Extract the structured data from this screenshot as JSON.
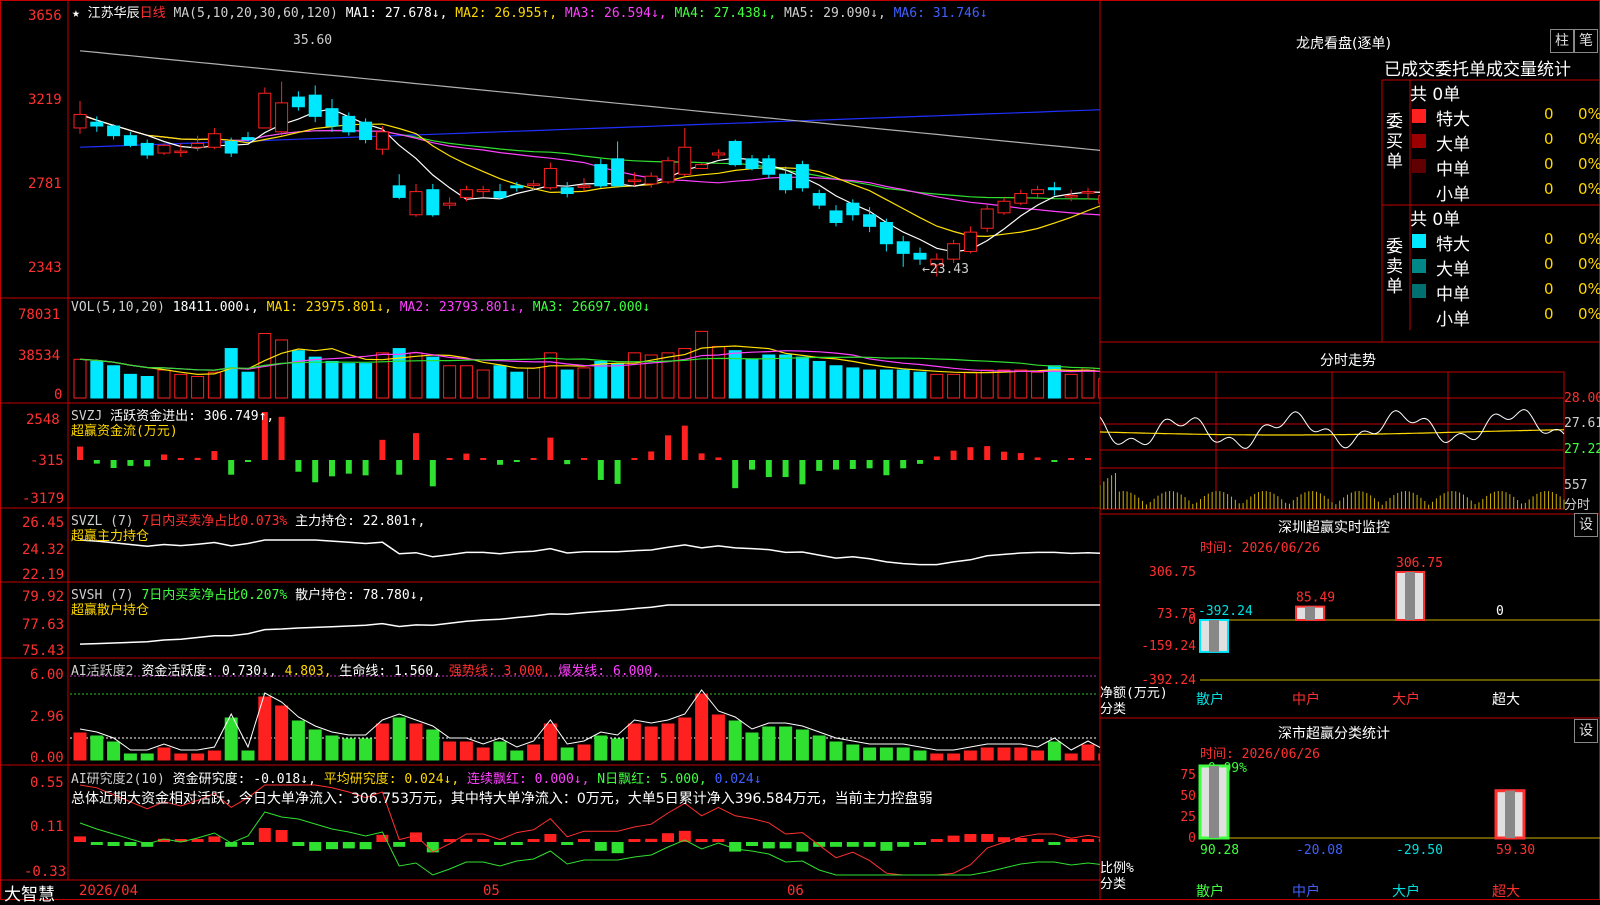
{
  "colors": {
    "up": "#ff2020",
    "down": "#00e8ff",
    "grid": "#c00000",
    "bg": "#000000",
    "ma1": "#ffffff",
    "ma2": "#ffe000",
    "ma3": "#ff40ff",
    "ma4": "#30e030",
    "ma5": "#b0b0b0",
    "ma6": "#2030ff"
  },
  "brand": "大智慧",
  "main": {
    "star": "★",
    "stock": "江苏华辰",
    "period": "日线",
    "ma_label": "MA(5,10,20,30,60,120)",
    "ma1": "MA1: 27.678↓,",
    "ma2": "MA2: 26.955↑,",
    "ma3": "MA3: 26.594↓,",
    "ma4": "MA4: 27.438↓,",
    "ma5": "MA5: 29.090↓,",
    "ma6": "MA6: 31.746↓",
    "y_ticks": [
      "3656",
      "3219",
      "2781",
      "2343"
    ],
    "high_note": "35.60",
    "low_note": "←23.43"
  },
  "vol": {
    "label": "VOL(5,10,20)",
    "v": "18411.000↓,",
    "ma1": "MA1: 23975.801↓,",
    "ma2": "MA2: 23793.801↓,",
    "ma3": "MA3: 26697.000↓",
    "y_ticks": [
      "78031",
      "38534",
      "0"
    ]
  },
  "svzj": {
    "label": "SVZJ",
    "t1": "活跃资金进出: 306.749↑,",
    "t2": "超赢资金流(万元)",
    "y_ticks": [
      "2548",
      "-315",
      "-3179"
    ]
  },
  "svzl": {
    "label": "SVZL (7)",
    "t1": "7日内买卖净占比0.073%",
    "t2": "主力持仓: 22.801↑,",
    "t3": "超赢主力持仓",
    "y_ticks": [
      "26.45",
      "24.32",
      "22.19"
    ]
  },
  "svsh": {
    "label": "SVSH (7)",
    "t1": "7日内买卖净占比0.207%",
    "t2": "散户持仓: 78.780↓,",
    "t3": "超赢散户持仓",
    "y_ticks": [
      "79.92",
      "77.63",
      "75.43"
    ]
  },
  "ai1": {
    "label": "AI活跃度2",
    "t1": "资金活跃度: 0.730↓,",
    "t2": "4.803,",
    "t3": "生命线: 1.560,",
    "t4": "强势线: 3.000,",
    "t5": "爆发线: 6.000,",
    "y_ticks": [
      "6.00",
      "2.96",
      "0.00"
    ]
  },
  "ai2": {
    "label": "AI研究度2(10)",
    "t1": "资金研究度: -0.018↓,",
    "t2": "平均研究度: 0.024↓,",
    "t3": "连续飘红: 0.000↓,",
    "t4": "N日飘红: 5.000,",
    "t5": "0.024↓",
    "summary": "总体近期大资金相对活跃，今日大单净流入：306.753万元，其中特大单净流入：0万元，大单5日累计净入396.584万元，当前主力控盘弱",
    "y_ticks": [
      "0.55",
      "0.11",
      "-0.33"
    ]
  },
  "date_axis": {
    "d1": "2026/04",
    "d2": "05",
    "d3": "06"
  },
  "right": {
    "title": "龙虎看盘(逐单)",
    "btn1": "柱",
    "btn2": "笔",
    "subtitle": "已成交委托单成交量统计",
    "buy": {
      "side": "委买单",
      "total": "共 0单",
      "rows": [
        {
          "name": "特大",
          "vol": "0",
          "pct": "0%",
          "color": "#ff2020"
        },
        {
          "name": "大单",
          "vol": "0",
          "pct": "0%",
          "color": "#9a0000"
        },
        {
          "name": "中单",
          "vol": "0",
          "pct": "0%",
          "color": "#600000"
        },
        {
          "name": "小单",
          "vol": "0",
          "pct": "0%",
          "color": ""
        }
      ]
    },
    "sell": {
      "side": "委卖单",
      "total": "共 0单",
      "rows": [
        {
          "name": "特大",
          "vol": "0",
          "pct": "0%",
          "color": "#00e8ff"
        },
        {
          "name": "大单",
          "vol": "0",
          "pct": "0%",
          "color": "#008888"
        },
        {
          "name": "中单",
          "vol": "0",
          "pct": "0%",
          "color": "#007070"
        },
        {
          "name": "小单",
          "vol": "0",
          "pct": "0%",
          "color": ""
        }
      ]
    },
    "intraday": {
      "title": "分时走势",
      "p1": "28.00",
      "p2": "27.61",
      "p3": "27.22",
      "vol": "557",
      "unit": "分时"
    },
    "monitor": {
      "title": "深圳超赢实时监控",
      "btn": "设",
      "time": "时间: 2026/06/26",
      "y_ticks": [
        "306.75",
        "73.75",
        "0",
        "-159.24",
        "-392.24"
      ],
      "ylabel1": "净额(万元)",
      "ylabel2": "分类",
      "cats": [
        "散户",
        "中户",
        "大户",
        "超大"
      ],
      "values": [
        -392.24,
        85.49,
        306.75,
        0
      ],
      "labels": [
        "-392.24",
        "85.49",
        "306.75",
        "0"
      ]
    },
    "classify": {
      "title": "深市超赢分类统计",
      "btn": "设",
      "time": "时间: 2026/06/26",
      "top_label": "-0.09%",
      "y_ticks": [
        "75",
        "50",
        "25",
        "0"
      ],
      "ylabel1": "比例%",
      "ylabel2": "分类",
      "cats": [
        "散户",
        "中户",
        "大户",
        "超大"
      ],
      "values": [
        90.28,
        -20.08,
        -29.5,
        59.3
      ],
      "labels": [
        "90.28",
        "-20.08",
        "-29.50",
        "59.30"
      ]
    }
  },
  "chart_data": {
    "type": "candlestick",
    "x": [
      "2026/04",
      "",
      "",
      "",
      "",
      "",
      "",
      "",
      "",
      "",
      "",
      "",
      "",
      "",
      "",
      "",
      "",
      "",
      "",
      "",
      "",
      "",
      "",
      "",
      "",
      "05",
      "",
      "",
      "",
      "",
      "",
      "",
      "",
      "",
      "",
      "",
      "",
      "",
      "",
      "",
      "",
      "",
      "06",
      "",
      "",
      "",
      "",
      "",
      "",
      "",
      "",
      "",
      "",
      "",
      "",
      "",
      "",
      "",
      "",
      "",
      "",
      ""
    ],
    "open": [
      31.2,
      31.5,
      31.3,
      30.8,
      30.4,
      29.9,
      30.0,
      30.2,
      30.2,
      30.5,
      30.7,
      31.2,
      31.0,
      32.8,
      32.9,
      32.2,
      31.8,
      31.5,
      30.1,
      28.2,
      26.7,
      28.0,
      27.2,
      27.6,
      27.9,
      27.9,
      28.2,
      28.3,
      28.1,
      28.1,
      28.2,
      29.3,
      29.6,
      28.5,
      28.3,
      28.4,
      28.8,
      29.1,
      29.8,
      30.5,
      29.6,
      29.6,
      28.8,
      29.3,
      27.8,
      26.9,
      27.3,
      26.7,
      26.3,
      25.3,
      24.7,
      24.1,
      24.4,
      24.8,
      26.0,
      26.8,
      27.3,
      27.8,
      28.1,
      27.7,
      27.9,
      27.3
    ],
    "close": [
      31.9,
      31.3,
      30.8,
      30.3,
      29.8,
      30.3,
      30.0,
      30.4,
      30.9,
      29.9,
      30.6,
      33.0,
      32.5,
      32.3,
      31.8,
      31.3,
      31.0,
      30.6,
      31.0,
      27.6,
      27.9,
      26.7,
      27.3,
      28.0,
      28.0,
      27.6,
      28.1,
      28.3,
      29.1,
      27.8,
      28.2,
      28.2,
      28.2,
      28.5,
      28.7,
      29.5,
      30.2,
      29.3,
      29.9,
      29.3,
      29.1,
      28.8,
      28.0,
      28.1,
      27.2,
      26.3,
      26.7,
      26.1,
      25.2,
      24.7,
      24.4,
      24.4,
      25.2,
      25.8,
      27.0,
      27.4,
      27.8,
      28.0,
      28.0,
      27.7,
      27.9,
      27.7
    ],
    "high": [
      32.6,
      31.8,
      31.4,
      31.0,
      30.6,
      30.4,
      30.4,
      30.8,
      31.2,
      30.7,
      31.0,
      33.3,
      33.6,
      33.1,
      33.4,
      32.7,
      32.0,
      31.7,
      31.3,
      28.8,
      28.3,
      28.3,
      27.6,
      28.2,
      28.2,
      28.3,
      28.4,
      28.5,
      29.4,
      28.4,
      28.6,
      29.6,
      30.5,
      28.9,
      28.9,
      29.7,
      31.2,
      29.4,
      30.1,
      30.6,
      29.8,
      29.8,
      29.2,
      29.5,
      28.0,
      27.2,
      27.5,
      27.1,
      26.5,
      25.6,
      25.0,
      24.7,
      25.4,
      26.1,
      27.2,
      27.6,
      28.0,
      28.2,
      28.4,
      28.0,
      28.1,
      28.2
    ],
    "low": [
      30.9,
      31.0,
      30.6,
      30.2,
      29.6,
      29.8,
      29.7,
      30.0,
      30.1,
      29.7,
      30.5,
      31.2,
      30.8,
      32.1,
      31.5,
      31.0,
      30.8,
      30.4,
      29.8,
      27.5,
      26.6,
      26.6,
      27.0,
      27.4,
      27.6,
      27.5,
      27.9,
      28.0,
      28.0,
      27.6,
      27.9,
      28.1,
      28.1,
      28.2,
      28.1,
      28.3,
      28.7,
      29.1,
      29.6,
      29.2,
      29.0,
      28.6,
      27.8,
      27.9,
      27.0,
      26.1,
      26.4,
      25.8,
      24.8,
      24.0,
      24.1,
      23.5,
      24.2,
      24.7,
      25.8,
      26.7,
      27.2,
      27.6,
      27.7,
      27.4,
      27.5,
      27.3
    ],
    "volume_k": [
      36,
      34,
      30,
      22,
      20,
      26,
      22,
      20,
      24,
      46,
      24,
      60,
      54,
      44,
      38,
      34,
      32,
      32,
      42,
      46,
      42,
      38,
      30,
      30,
      26,
      30,
      24,
      28,
      42,
      26,
      28,
      34,
      32,
      42,
      40,
      42,
      46,
      62,
      48,
      44,
      36,
      40,
      40,
      38,
      34,
      30,
      28,
      26,
      26,
      26,
      24,
      22,
      22,
      24,
      26,
      26,
      26,
      24,
      30,
      22,
      28,
      18
    ],
    "ylim": [
      22.8,
      36.9
    ],
    "ylabel": "",
    "xlabel": ""
  }
}
